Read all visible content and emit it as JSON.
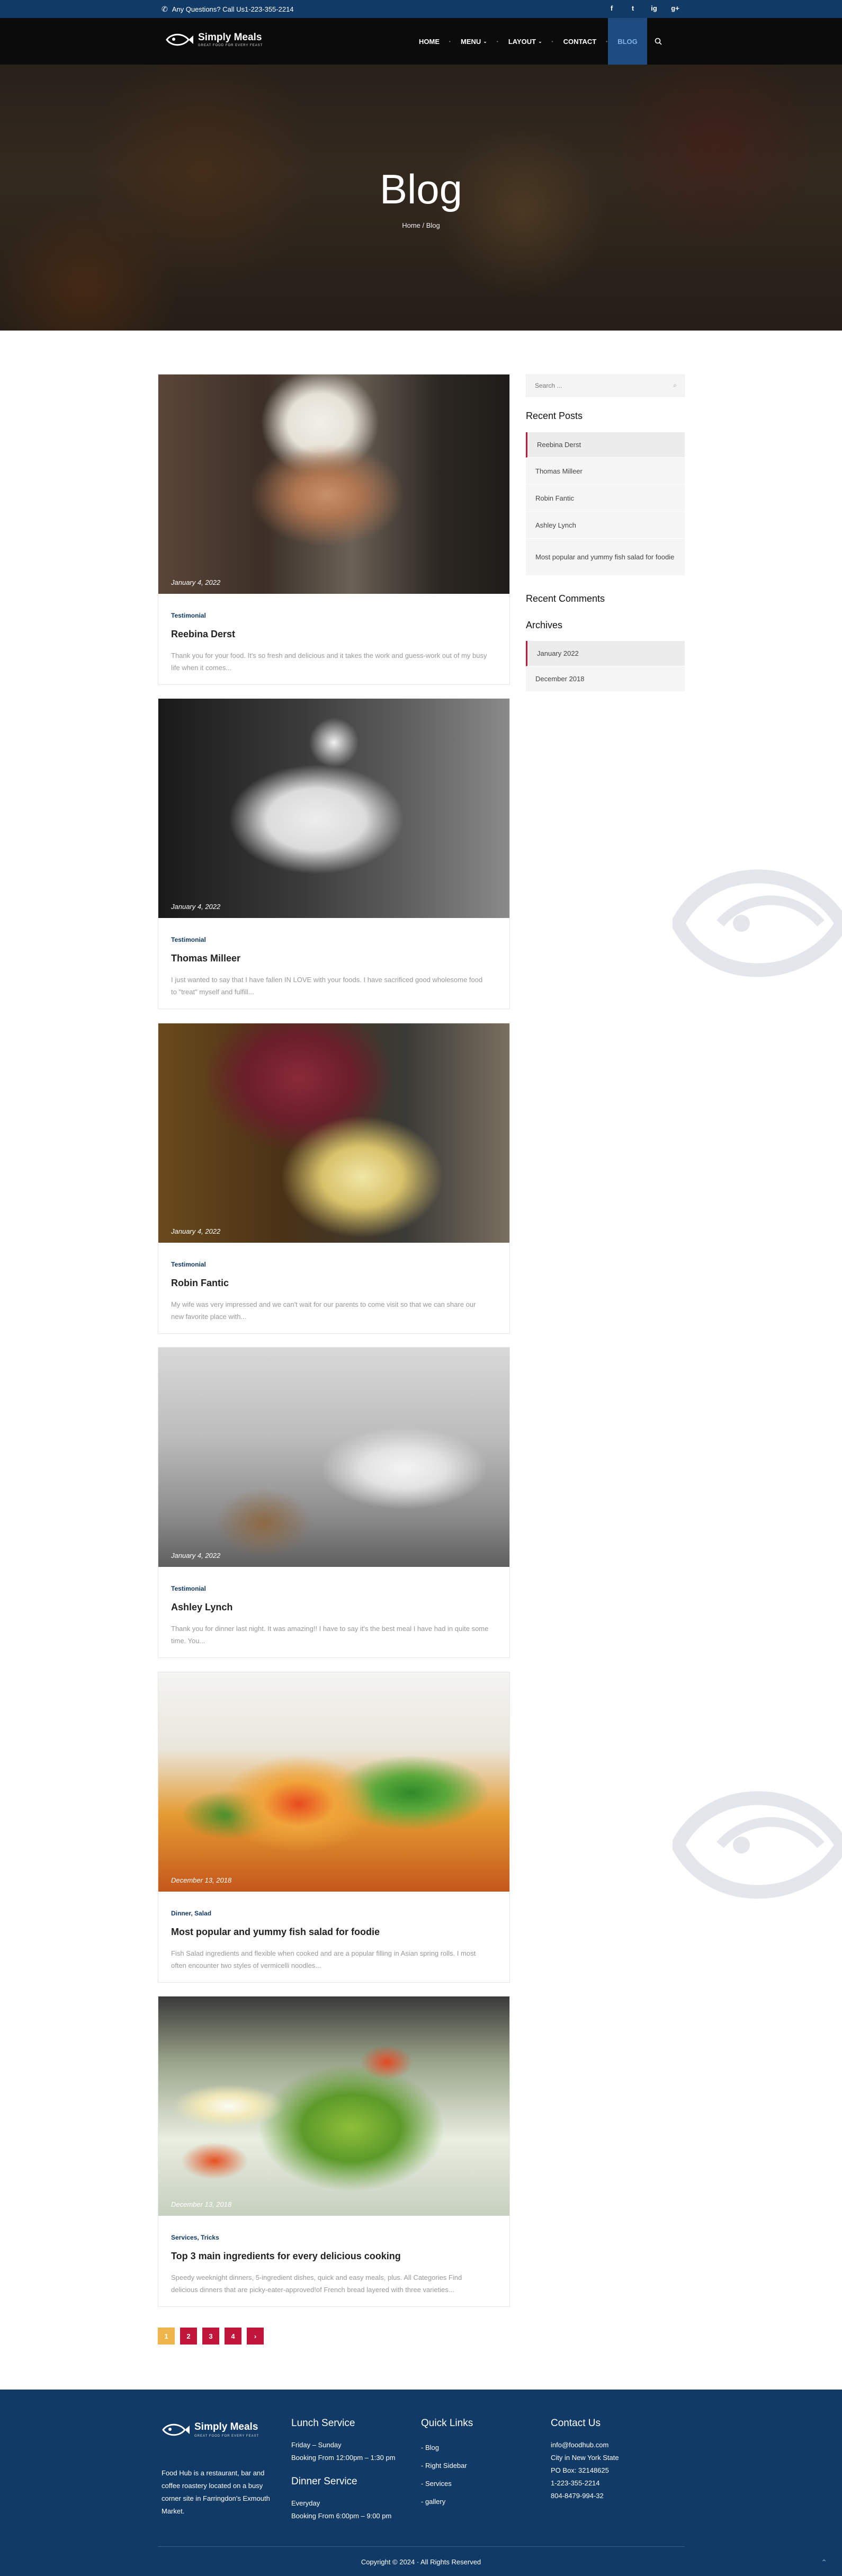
{
  "topbar": {
    "phone_icon": "phone-icon",
    "phone_text": "Any Questions? Call Us1-223-355-2214",
    "social": [
      "f",
      "t",
      "ig",
      "g+"
    ]
  },
  "brand": {
    "name": "Simply Meals",
    "tagline": "GREAT FOOD FOR EVERY FEAST"
  },
  "nav": {
    "items": [
      {
        "label": "HOME",
        "caret": ""
      },
      {
        "label": "MENU",
        "caret": "⌄"
      },
      {
        "label": "LAYOUT",
        "caret": "⌄"
      },
      {
        "label": "CONTACT",
        "caret": ""
      },
      {
        "label": "BLOG",
        "caret": ""
      }
    ],
    "active": "BLOG"
  },
  "hero": {
    "title": "Blog",
    "breadcrumb": "Home / Blog"
  },
  "posts": [
    {
      "date": "January 4, 2022",
      "categories": "Testimonial",
      "title": "Reebina Derst",
      "excerpt": "Thank you for your food. It's so fresh and delicious and it takes the work and guess-work out of my busy life when it comes..."
    },
    {
      "date": "January 4, 2022",
      "categories": "Testimonial",
      "title": "Thomas Milleer",
      "excerpt": "I just wanted to say that I have fallen IN LOVE with your foods. I have sacrificed good wholesome food to \"treat\" myself and fulfill..."
    },
    {
      "date": "January 4, 2022",
      "categories": "Testimonial",
      "title": "Robin Fantic",
      "excerpt": "My wife was very impressed and we can't wait for our parents to come visit so that we can share our new favorite place with..."
    },
    {
      "date": "January 4, 2022",
      "categories": "Testimonial",
      "title": "Ashley Lynch",
      "excerpt": "Thank you for dinner last night. It was amazing!! I have to say it's the best meal I have had in quite some time. You..."
    },
    {
      "date": "December 13, 2018",
      "categories": "Dinner, Salad",
      "title": "Most popular and yummy fish salad for foodie",
      "excerpt": "Fish Salad ingredients and flexible when cooked and are a popular filling in Asian spring rolls. I most often encounter two styles of vermicelli noodles..."
    },
    {
      "date": "December 13, 2018",
      "categories": "Services, Tricks",
      "title": "Top 3 main ingredients for every delicious cooking",
      "excerpt": "Speedy weeknight dinners, 5-ingredient dishes, quick and easy meals, plus. All Categories Find delicious dinners that are picky-eater-approved!of French bread layered with three varieties..."
    }
  ],
  "sidebar": {
    "search_placeholder": "Search ...",
    "search_icon": "search-icon",
    "recent_posts_title": "Recent Posts",
    "recent_posts": [
      "Reebina Derst",
      "Thomas Milleer",
      "Robin Fantic",
      "Ashley Lynch",
      "Most popular and yummy fish salad for foodie"
    ],
    "recent_comments_title": "Recent Comments",
    "archives_title": "Archives",
    "archives": [
      "January 2022",
      "December 2018"
    ]
  },
  "pagination": {
    "pages": [
      "1",
      "2",
      "3",
      "4"
    ],
    "current": "1",
    "next": "›"
  },
  "footer": {
    "description": "Food Hub is a restaurant, bar and coffee roastery located on a busy corner site in Farringdon's Exmouth Market.",
    "lunch_title": "Lunch Service",
    "lunch_days": "Friday – Sunday",
    "lunch_hours": "Booking From 12:00pm – 1:30 pm",
    "dinner_title": "Dinner Service",
    "dinner_days": "Everyday",
    "dinner_hours": "Booking From 6:00pm – 9:00 pm",
    "quick_links_title": "Quick Links",
    "quick_links": [
      "- Blog",
      "- Right Sidebar",
      "- Services",
      "- gallery"
    ],
    "contact_title": "Contact Us",
    "contact_lines": [
      "info@foodhub.com",
      "City in New York State",
      "PO Box: 32148625",
      "1-223-355-2214",
      "804-8479-994-32"
    ],
    "copyright": "Copyright © 2024  ·  All Rights Reserved",
    "to_top_icon": "chevron-up-icon"
  },
  "colors": {
    "top_bar": "#123a66",
    "nav_bg": "#0b0b0b",
    "accent": "#c0163a",
    "pager_current": "#f0b54a",
    "footer_bg": "#123a66"
  }
}
